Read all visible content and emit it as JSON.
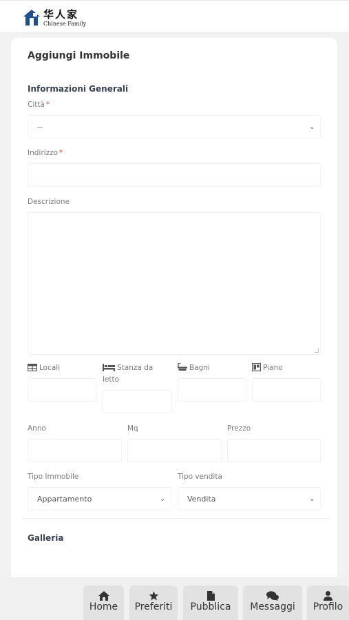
{
  "header": {
    "logo_cn": "华人家",
    "logo_en": "Chinese Family"
  },
  "form": {
    "title": "Aggiungi Immobile",
    "section_general": "Informazioni Generali",
    "city_label": "Città",
    "city_value": "--",
    "required_mark": "*",
    "address_label": "Indirizzo",
    "description_label": "Descrizione",
    "rooms_label": "Locali",
    "bedroom_label": "Stanza da letto",
    "bath_label": "Bagni",
    "floor_label": "Piano",
    "year_label": "Anno",
    "sqm_label": "Mq",
    "price_label": "Prezzo",
    "type_label": "Tipo Immobile",
    "type_value": "Appartamento",
    "sale_type_label": "Tipo vendita",
    "sale_type_value": "Vendita",
    "section_gallery": "Galleria"
  },
  "nav": {
    "home": "Home",
    "favorites": "Preferiti",
    "publish": "Pubblica",
    "messages": "Messaggi",
    "profile": "Profilo"
  },
  "colors": {
    "brand_blue": "#1f4e8c",
    "required": "#ef4444",
    "background": "#f2f2f2"
  }
}
